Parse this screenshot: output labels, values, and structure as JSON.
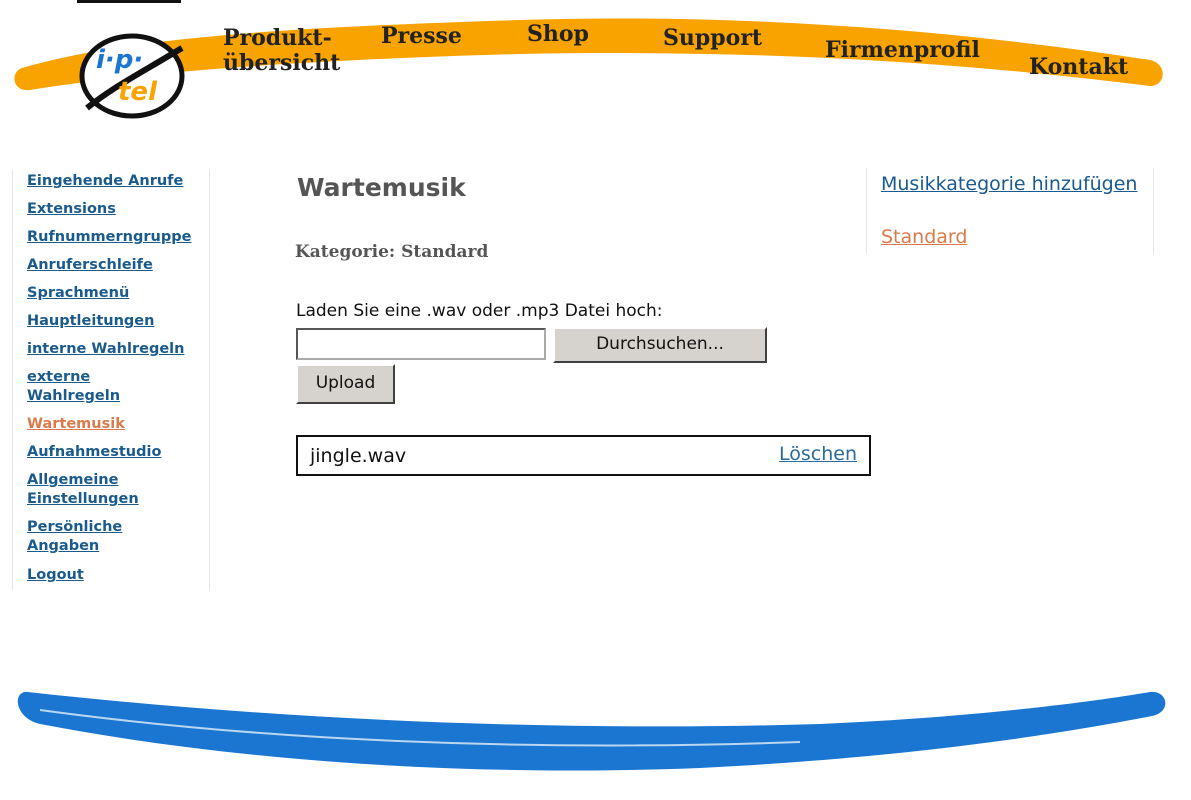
{
  "colors": {
    "accent_orange": "#f8a300",
    "footer_blue": "#1b76d1",
    "link_blue": "#1a5a8c",
    "active_link": "#d97b4a"
  },
  "logo": {
    "text_top": "i·p·",
    "text_bottom": "tel"
  },
  "top_nav": {
    "items": [
      {
        "label_line1": "Produkt-",
        "label_line2": "übersicht"
      },
      {
        "label": "Presse"
      },
      {
        "label": "Shop"
      },
      {
        "label": "Support"
      },
      {
        "label": "Firmenprofil"
      },
      {
        "label": "Kontakt"
      }
    ]
  },
  "sidebar": {
    "items": [
      {
        "label": "Eingehende Anrufe"
      },
      {
        "label": "Extensions"
      },
      {
        "label": "Rufnummerngruppe"
      },
      {
        "label": "Anruferschleife"
      },
      {
        "label": "Sprachmenü"
      },
      {
        "label": "Hauptleitungen"
      },
      {
        "label": "interne Wahlregeln"
      },
      {
        "label": "externe Wahlregeln"
      },
      {
        "label": "Wartemusik",
        "active": true
      },
      {
        "label": "Aufnahmestudio"
      },
      {
        "label": "Allgemeine Einstellungen"
      },
      {
        "label": "Persönliche Angaben"
      },
      {
        "label": "Logout"
      }
    ]
  },
  "main": {
    "title": "Wartemusik",
    "category_label": "Kategorie: Standard",
    "upload_label": "Laden Sie eine .wav oder .mp3 Datei hoch:",
    "file_input_value": "",
    "browse_button": "Durchsuchen...",
    "upload_button": "Upload",
    "files": [
      {
        "name": "jingle.wav",
        "delete_label": "Löschen"
      }
    ]
  },
  "right_panel": {
    "add_category": "Musikkategorie hinzufügen",
    "categories": [
      {
        "label": "Standard",
        "active": true
      }
    ]
  }
}
